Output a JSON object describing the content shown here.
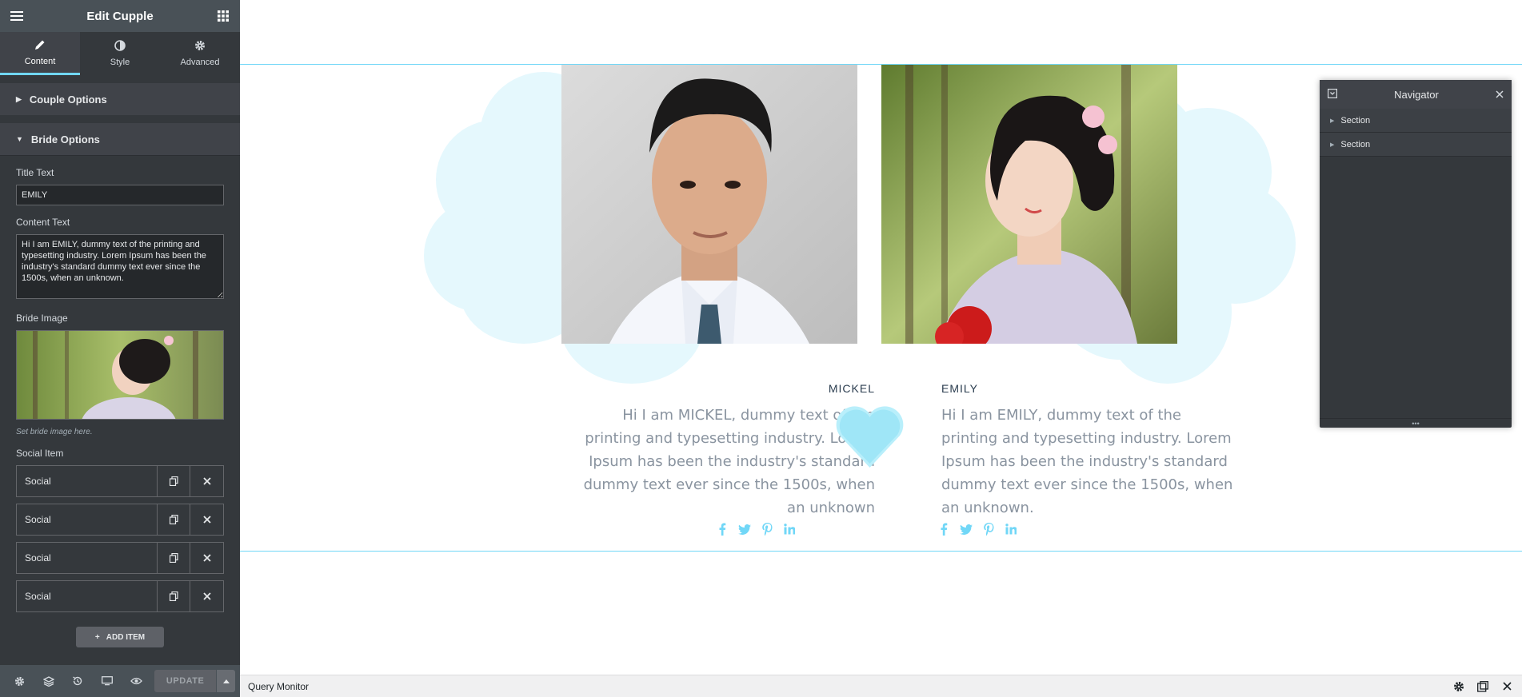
{
  "panel": {
    "title": "Edit Cupple",
    "tabs": [
      {
        "label": "Content",
        "icon": "pencil-icon"
      },
      {
        "label": "Style",
        "icon": "half-circle-icon"
      },
      {
        "label": "Advanced",
        "icon": "gear-icon"
      }
    ],
    "sections": {
      "couple": "Couple Options",
      "bride": "Bride Options"
    },
    "title_text": {
      "label": "Title Text",
      "value": "EMILY"
    },
    "content_text": {
      "label": "Content Text",
      "value": "Hi I am EMILY, dummy text of the printing and typesetting industry. Lorem Ipsum has been the industry's standard dummy text ever since the 1500s, when an unknown."
    },
    "bride_image": {
      "label": "Bride Image",
      "hint": "Set bride image here."
    },
    "social": {
      "label": "Social Item",
      "items": [
        "Social",
        "Social",
        "Social",
        "Social"
      ],
      "add_label": "ADD ITEM"
    },
    "footer": {
      "update_label": "UPDATE"
    }
  },
  "couple": {
    "groom": {
      "name": "MICKEL",
      "bio": "Hi I am MICKEL, dummy text of the printing and typesetting industry. Lorem Ipsum has been the industry's standard dummy text ever since the 1500s, when an unknown"
    },
    "bride": {
      "name": "EMILY",
      "bio": "Hi I am EMILY, dummy text of the printing and typesetting industry. Lorem Ipsum has been the industry's standard dummy text ever since the 1500s, when an unknown."
    },
    "social_icons": [
      "facebook-icon",
      "twitter-icon",
      "pinterest-icon",
      "linkedin-icon"
    ]
  },
  "navigator": {
    "title": "Navigator",
    "items": [
      "Section",
      "Section"
    ]
  },
  "query_monitor": {
    "title": "Query Monitor"
  },
  "colors": {
    "accent": "#71d7f7",
    "panel_bg": "#34383c",
    "cloud": "#e5f8fd",
    "heart": "#9fe6f7"
  }
}
